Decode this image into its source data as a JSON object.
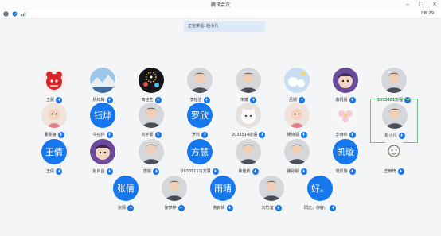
{
  "app": {
    "title": "腾讯会议",
    "time": "08:29",
    "speaking_label": "正在讲话: 赵小凡"
  },
  "colors": {
    "accent": "#1878ea",
    "avatar_text_bg": "#1777ec",
    "speaking_bg": "#dce9f8",
    "active_border": "#6cc18a"
  },
  "participants": [
    {
      "name": "王晨",
      "avatar": "red-mascot"
    },
    {
      "name": "杨红梅",
      "avatar": "landscape"
    },
    {
      "name": "高佳艺",
      "avatar": "fireworks"
    },
    {
      "name": "李钰洁",
      "avatar": "portrait"
    },
    {
      "name": "宋斌",
      "avatar": "portrait"
    },
    {
      "name": "吕娜",
      "avatar": "snow-scene"
    },
    {
      "name": "桑祝晨",
      "avatar": "cartoon"
    },
    {
      "name": "1933481彭程",
      "avatar": "portrait"
    },
    {
      "name": "董雯静",
      "avatar": "baby-photo"
    },
    {
      "name": "牛钰烨",
      "avatar": "text",
      "avatar_text": "钰烨"
    },
    {
      "name": "刘宇豪",
      "avatar": "portrait"
    },
    {
      "name": "罗欣",
      "avatar": "text",
      "avatar_text": "罗欣"
    },
    {
      "name": "2033514唐语",
      "avatar": "cat"
    },
    {
      "name": "樊诗慧",
      "avatar": "baby-photo"
    },
    {
      "name": "李诗吟",
      "avatar": "flower"
    },
    {
      "name": "赵小凡",
      "avatar": "portrait"
    },
    {
      "name": "王倩",
      "avatar": "text",
      "avatar_text": "王倩"
    },
    {
      "name": "赵启昌",
      "avatar": "cartoon"
    },
    {
      "name": "唐锐",
      "avatar": "portrait"
    },
    {
      "name": "2033511马方慧",
      "avatar": "text",
      "avatar_text": "方慧"
    },
    {
      "name": "徐佳依",
      "avatar": "portrait"
    },
    {
      "name": "薛孙妮",
      "avatar": "portrait"
    },
    {
      "name": "范凯璇",
      "avatar": "text",
      "avatar_text": "凯璇"
    },
    {
      "name": "王雨琦",
      "avatar": "sketch"
    },
    {
      "name": "张倩",
      "avatar": "text",
      "avatar_text": "张倩"
    },
    {
      "name": "徐梦婷",
      "avatar": "portrait"
    },
    {
      "name": "黄雨晴",
      "avatar": "text",
      "avatar_text": "雨晴"
    },
    {
      "name": "刘竹滢",
      "avatar": "portrait"
    },
    {
      "name": "同志，你好。",
      "avatar": "text",
      "avatar_text": "好。"
    }
  ]
}
